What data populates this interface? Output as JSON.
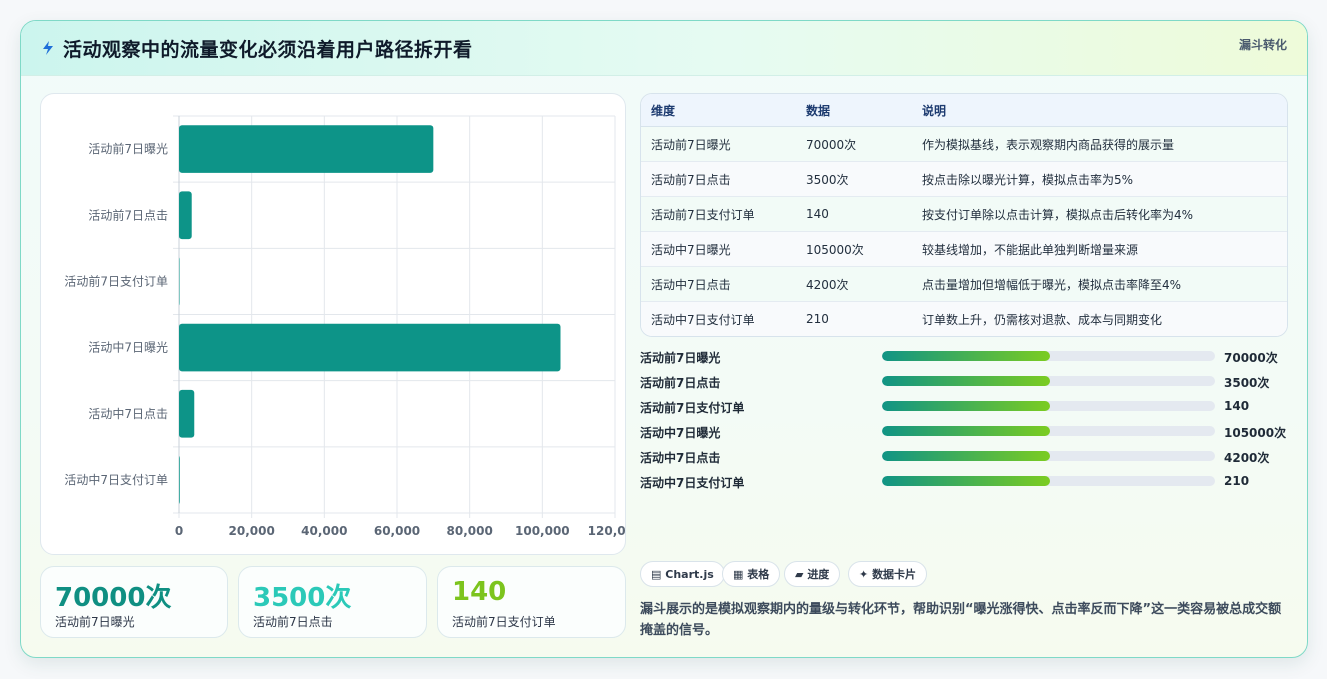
{
  "header": {
    "title": "活动观察中的流量变化必须沿着用户路径拆开看",
    "badge": "漏斗转化",
    "icon": "lightning-icon"
  },
  "chart_data": {
    "type": "bar",
    "orientation": "horizontal",
    "categories": [
      "活动前7日曝光",
      "活动前7日点击",
      "活动前7日支付订单",
      "活动中7日曝光",
      "活动中7日点击",
      "活动中7日支付订单"
    ],
    "values": [
      70000,
      3500,
      140,
      105000,
      4200,
      210
    ],
    "x_ticks": [
      "0",
      "20,000",
      "40,000",
      "60,000",
      "80,000",
      "100,000",
      "120,000"
    ],
    "xlim": [
      0,
      120000
    ],
    "bar_color": "#0d9488",
    "grid": true,
    "legend": "none"
  },
  "kpis": [
    {
      "value": "70000次",
      "label": "活动前7日曝光",
      "color": "#0f8f82"
    },
    {
      "value": "3500次",
      "label": "活动前7日点击",
      "color": "#2bc9b8"
    },
    {
      "value": "140",
      "label": "活动前7日支付订单",
      "color": "#7cc41d"
    }
  ],
  "table": {
    "headers": [
      "维度",
      "数据",
      "说明"
    ],
    "rows": [
      [
        "活动前7日曝光",
        "70000次",
        "作为模拟基线，表示观察期内商品获得的展示量"
      ],
      [
        "活动前7日点击",
        "3500次",
        "按点击除以曝光计算，模拟点击率为5%"
      ],
      [
        "活动前7日支付订单",
        "140",
        "按支付订单除以点击计算，模拟点击后转化率为4%"
      ],
      [
        "活动中7日曝光",
        "105000次",
        "较基线增加，不能据此单独判断增量来源"
      ],
      [
        "活动中7日点击",
        "4200次",
        "点击量增加但增幅低于曝光，模拟点击率降至4%"
      ],
      [
        "活动中7日支付订单",
        "210",
        "订单数上升，仍需核对退款、成本与同期变化"
      ]
    ]
  },
  "progress": [
    {
      "label": "活动前7日曝光",
      "value": "70000次",
      "fill": 0.505
    },
    {
      "label": "活动前7日点击",
      "value": "3500次",
      "fill": 0.505
    },
    {
      "label": "活动前7日支付订单",
      "value": "140",
      "fill": 0.505
    },
    {
      "label": "活动中7日曝光",
      "value": "105000次",
      "fill": 0.505
    },
    {
      "label": "活动中7日点击",
      "value": "4200次",
      "fill": 0.505
    },
    {
      "label": "活动中7日支付订单",
      "value": "210",
      "fill": 0.505
    }
  ],
  "chips": [
    {
      "icon": "chart-icon",
      "glyph": "▤",
      "label": "Chart.js"
    },
    {
      "icon": "table-icon",
      "glyph": "▦",
      "label": "表格"
    },
    {
      "icon": "progress-icon",
      "glyph": "▰",
      "label": "进度"
    },
    {
      "icon": "sparkle-icon",
      "glyph": "✦",
      "label": "数据卡片"
    }
  ],
  "note": "漏斗展示的是模拟观察期内的量级与转化环节，帮助识别“曝光涨得快、点击率反而下降”这一类容易被总成交额掩盖的信号。"
}
